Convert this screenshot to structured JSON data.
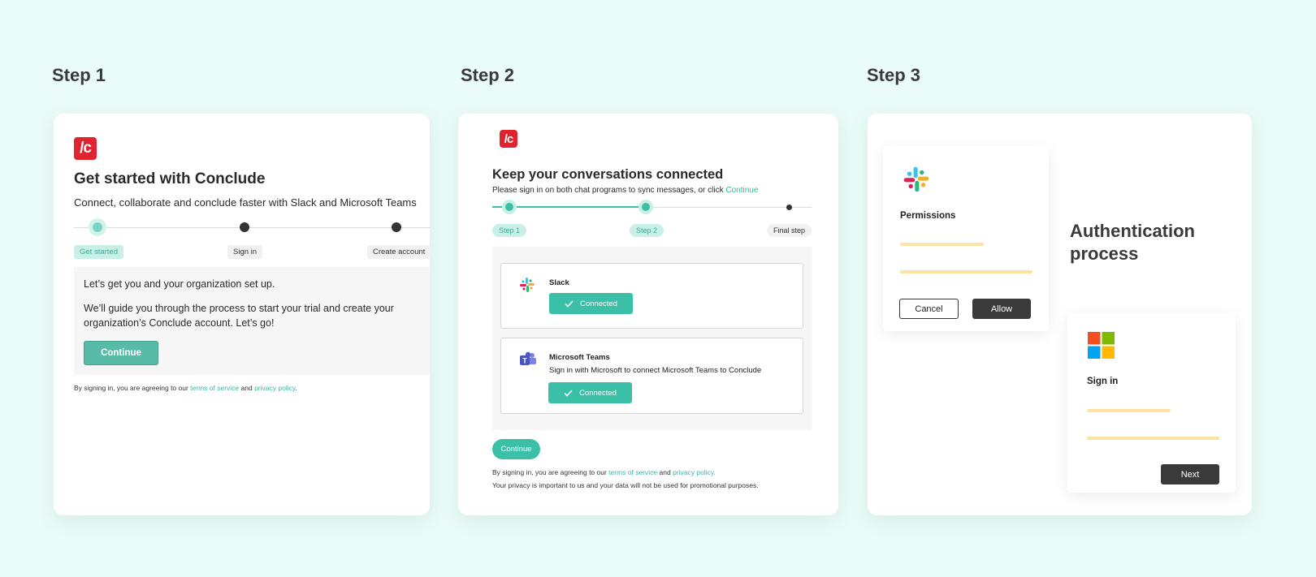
{
  "steps": {
    "step1": "Step 1",
    "step2": "Step 2",
    "step3": "Step 3"
  },
  "card1": {
    "logo_text": "/c",
    "title": "Get started with Conclude",
    "subtitle": "Connect, collaborate and conclude faster with Slack and Microsoft Teams",
    "progress": [
      "Get started",
      "Sign in",
      "Create account"
    ],
    "panel_line1": "Let’s get you and your organization set up.",
    "panel_line2": "We’ll guide you through the process to start your trial and create your organization’s Conclude account. Let’s go!",
    "continue_label": "Continue",
    "legal_prefix": "By signing in, you are agreeing to our ",
    "terms_link": "terms of service",
    "legal_and": " and ",
    "privacy_link": "privacy policy",
    "legal_end": "."
  },
  "card2": {
    "logo_text": "/c",
    "title": "Keep your conversations connected",
    "subtitle_prefix": "Please sign in on both chat programs to sync messages, or click ",
    "subtitle_link": "Continue",
    "progress": [
      "Step 1",
      "Step 2",
      "Final step"
    ],
    "slack": {
      "name": "Slack",
      "status": "Connected"
    },
    "teams": {
      "name": "Microsoft Teams",
      "description": "Sign in with Microsoft to connect Microsoft Teams to Conclude",
      "status": "Connected"
    },
    "continue_label": "Continue",
    "legal_prefix": "By signing in, you are agreeing to our ",
    "terms_link": "terms of service",
    "legal_and": " and ",
    "privacy_link": "privacy policy.",
    "privacy_note": "Your privacy is important to us and your data will not be used for promotional purposes."
  },
  "card3": {
    "permissions_title": "Permissions",
    "cancel_label": "Cancel",
    "allow_label": "Allow",
    "auth_text": "Authentication process",
    "signin_title": "Sign in",
    "next_label": "Next"
  },
  "icons": {
    "slack": "slack-logo-icon",
    "teams": "microsoft-teams-icon",
    "microsoft": "microsoft-logo-icon",
    "check": "check-icon"
  },
  "colors": {
    "background": "#eafcf8",
    "accent": "#3bbfa7",
    "brand_red": "#e0242f",
    "placeholder_line": "#fde3a3",
    "dark_button": "#3a3a3a"
  }
}
